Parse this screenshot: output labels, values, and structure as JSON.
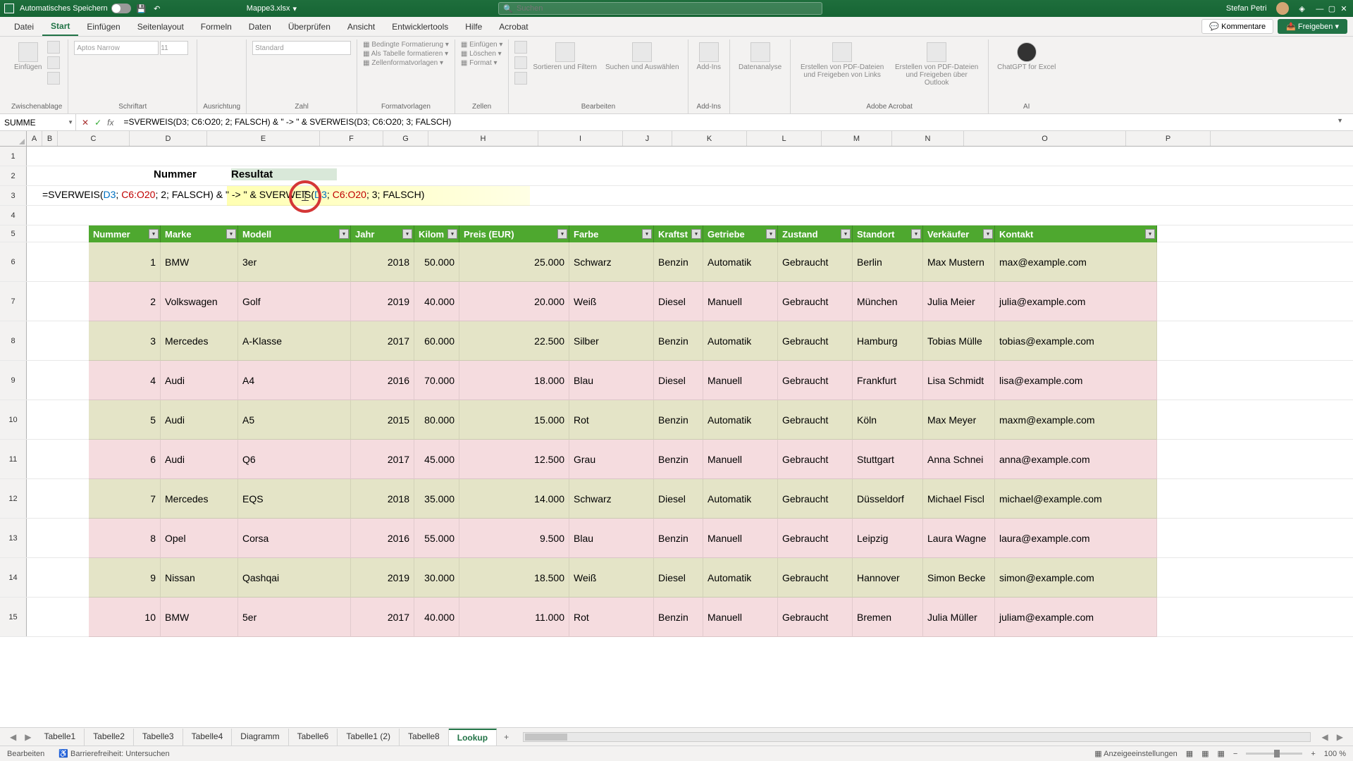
{
  "titlebar": {
    "autosave_label": "Automatisches Speichern",
    "filename": "Mappe3.xlsx",
    "search_placeholder": "Suchen",
    "username": "Stefan Petri"
  },
  "ribbon_tabs": [
    "Datei",
    "Start",
    "Einfügen",
    "Seitenlayout",
    "Formeln",
    "Daten",
    "Überprüfen",
    "Ansicht",
    "Entwicklertools",
    "Hilfe",
    "Acrobat"
  ],
  "ribbon_active_tab": "Start",
  "ribbon_buttons": {
    "comments": "Kommentare",
    "share": "Freigeben"
  },
  "ribbon_groups": {
    "clipboard": {
      "label": "Zwischenablage",
      "paste": "Einfügen"
    },
    "font": {
      "label": "Schriftart",
      "font_name": "Aptos Narrow",
      "font_size": "11"
    },
    "alignment": {
      "label": "Ausrichtung"
    },
    "number": {
      "label": "Zahl",
      "format": "Standard"
    },
    "styles": {
      "label": "Formatvorlagen",
      "cond": "Bedingte Formatierung",
      "table": "Als Tabelle formatieren",
      "cellstyles": "Zellenformatvorlagen"
    },
    "cells": {
      "label": "Zellen",
      "insert": "Einfügen",
      "delete": "Löschen",
      "format": "Format"
    },
    "editing": {
      "label": "Bearbeiten",
      "sort": "Sortieren und Filtern",
      "find": "Suchen und Auswählen"
    },
    "addins": {
      "label": "Add-Ins",
      "btn": "Add-Ins"
    },
    "analysis": {
      "label": "",
      "btn": "Datenanalyse"
    },
    "acrobat": {
      "label": "Adobe Acrobat",
      "pdf1": "Erstellen von PDF-Dateien und Freigeben von Links",
      "pdf2": "Erstellen von PDF-Dateien und Freigeben über Outlook"
    },
    "ai": {
      "label": "AI",
      "btn": "ChatGPT for Excel"
    }
  },
  "name_box": "SUMME",
  "formula_bar": "=SVERWEIS(D3; C6:O20; 2; FALSCH) & \" -> \" & SVERWEIS(D3; C6:O20; 3; FALSCH)",
  "columns": [
    "A",
    "B",
    "C",
    "D",
    "E",
    "F",
    "G",
    "H",
    "I",
    "J",
    "K",
    "L",
    "M",
    "N",
    "O",
    "P"
  ],
  "row_headers": [
    "1",
    "2",
    "3",
    "4",
    "5",
    "6",
    "7",
    "8",
    "9",
    "10",
    "11",
    "12",
    "13",
    "14",
    "15"
  ],
  "edit_row_labels": {
    "nummer": "Nummer",
    "resultat": "Resultat"
  },
  "formula_display": {
    "p1": "=SVERWEIS(",
    "d3": "D3",
    "sep1": "; ",
    "range": "C6:O20",
    "p2": "; 2; FALSCH) & \" -> \" & SVERWEIS(",
    "d3b": "D3",
    "sep2": "; ",
    "rangeb": "C6:O20",
    "p3": "; 3; FALSCH)"
  },
  "chart_data": {
    "type": "table",
    "headers": [
      "Nummer",
      "Marke",
      "Modell",
      "Jahr",
      "Kilom",
      "Preis (EUR)",
      "Farbe",
      "Kraftst",
      "Getriebe",
      "Zustand",
      "Standort",
      "Verkäufer",
      "Kontakt"
    ],
    "rows": [
      {
        "num": "1",
        "marke": "BMW",
        "modell": "3er",
        "jahr": "2018",
        "km": "50.000",
        "preis": "25.000",
        "farbe": "Schwarz",
        "kraft": "Benzin",
        "getriebe": "Automatik",
        "zustand": "Gebraucht",
        "standort": "Berlin",
        "verk": "Max Mustern",
        "kontakt": "max@example.com"
      },
      {
        "num": "2",
        "marke": "Volkswagen",
        "modell": "Golf",
        "jahr": "2019",
        "km": "40.000",
        "preis": "20.000",
        "farbe": "Weiß",
        "kraft": "Diesel",
        "getriebe": "Manuell",
        "zustand": "Gebraucht",
        "standort": "München",
        "verk": "Julia Meier",
        "kontakt": "julia@example.com"
      },
      {
        "num": "3",
        "marke": "Mercedes",
        "modell": "A-Klasse",
        "jahr": "2017",
        "km": "60.000",
        "preis": "22.500",
        "farbe": "Silber",
        "kraft": "Benzin",
        "getriebe": "Automatik",
        "zustand": "Gebraucht",
        "standort": "Hamburg",
        "verk": "Tobias Mülle",
        "kontakt": "tobias@example.com"
      },
      {
        "num": "4",
        "marke": "Audi",
        "modell": "A4",
        "jahr": "2016",
        "km": "70.000",
        "preis": "18.000",
        "farbe": "Blau",
        "kraft": "Diesel",
        "getriebe": "Manuell",
        "zustand": "Gebraucht",
        "standort": "Frankfurt",
        "verk": "Lisa Schmidt",
        "kontakt": "lisa@example.com"
      },
      {
        "num": "5",
        "marke": "Audi",
        "modell": "A5",
        "jahr": "2015",
        "km": "80.000",
        "preis": "15.000",
        "farbe": "Rot",
        "kraft": "Benzin",
        "getriebe": "Automatik",
        "zustand": "Gebraucht",
        "standort": "Köln",
        "verk": "Max Meyer",
        "kontakt": "maxm@example.com"
      },
      {
        "num": "6",
        "marke": "Audi",
        "modell": "Q6",
        "jahr": "2017",
        "km": "45.000",
        "preis": "12.500",
        "farbe": "Grau",
        "kraft": "Benzin",
        "getriebe": "Manuell",
        "zustand": "Gebraucht",
        "standort": "Stuttgart",
        "verk": "Anna Schnei",
        "kontakt": "anna@example.com"
      },
      {
        "num": "7",
        "marke": "Mercedes",
        "modell": "EQS",
        "jahr": "2018",
        "km": "35.000",
        "preis": "14.000",
        "farbe": "Schwarz",
        "kraft": "Diesel",
        "getriebe": "Automatik",
        "zustand": "Gebraucht",
        "standort": "Düsseldorf",
        "verk": "Michael Fiscl",
        "kontakt": "michael@example.com"
      },
      {
        "num": "8",
        "marke": "Opel",
        "modell": "Corsa",
        "jahr": "2016",
        "km": "55.000",
        "preis": "9.500",
        "farbe": "Blau",
        "kraft": "Benzin",
        "getriebe": "Manuell",
        "zustand": "Gebraucht",
        "standort": "Leipzig",
        "verk": "Laura Wagne",
        "kontakt": "laura@example.com"
      },
      {
        "num": "9",
        "marke": "Nissan",
        "modell": "Qashqai",
        "jahr": "2019",
        "km": "30.000",
        "preis": "18.500",
        "farbe": "Weiß",
        "kraft": "Diesel",
        "getriebe": "Automatik",
        "zustand": "Gebraucht",
        "standort": "Hannover",
        "verk": "Simon Becke",
        "kontakt": "simon@example.com"
      },
      {
        "num": "10",
        "marke": "BMW",
        "modell": "5er",
        "jahr": "2017",
        "km": "40.000",
        "preis": "11.000",
        "farbe": "Rot",
        "kraft": "Benzin",
        "getriebe": "Manuell",
        "zustand": "Gebraucht",
        "standort": "Bremen",
        "verk": "Julia Müller",
        "kontakt": "juliam@example.com"
      }
    ]
  },
  "sheet_tabs": [
    "Tabelle1",
    "Tabelle2",
    "Tabelle3",
    "Tabelle4",
    "Diagramm",
    "Tabelle6",
    "Tabelle1 (2)",
    "Tabelle8",
    "Lookup"
  ],
  "active_sheet": "Lookup",
  "status_bar": {
    "mode": "Bearbeiten",
    "accessibility": "Barrierefreiheit: Untersuchen",
    "display_settings": "Anzeigeeinstellungen",
    "zoom": "100 %"
  }
}
